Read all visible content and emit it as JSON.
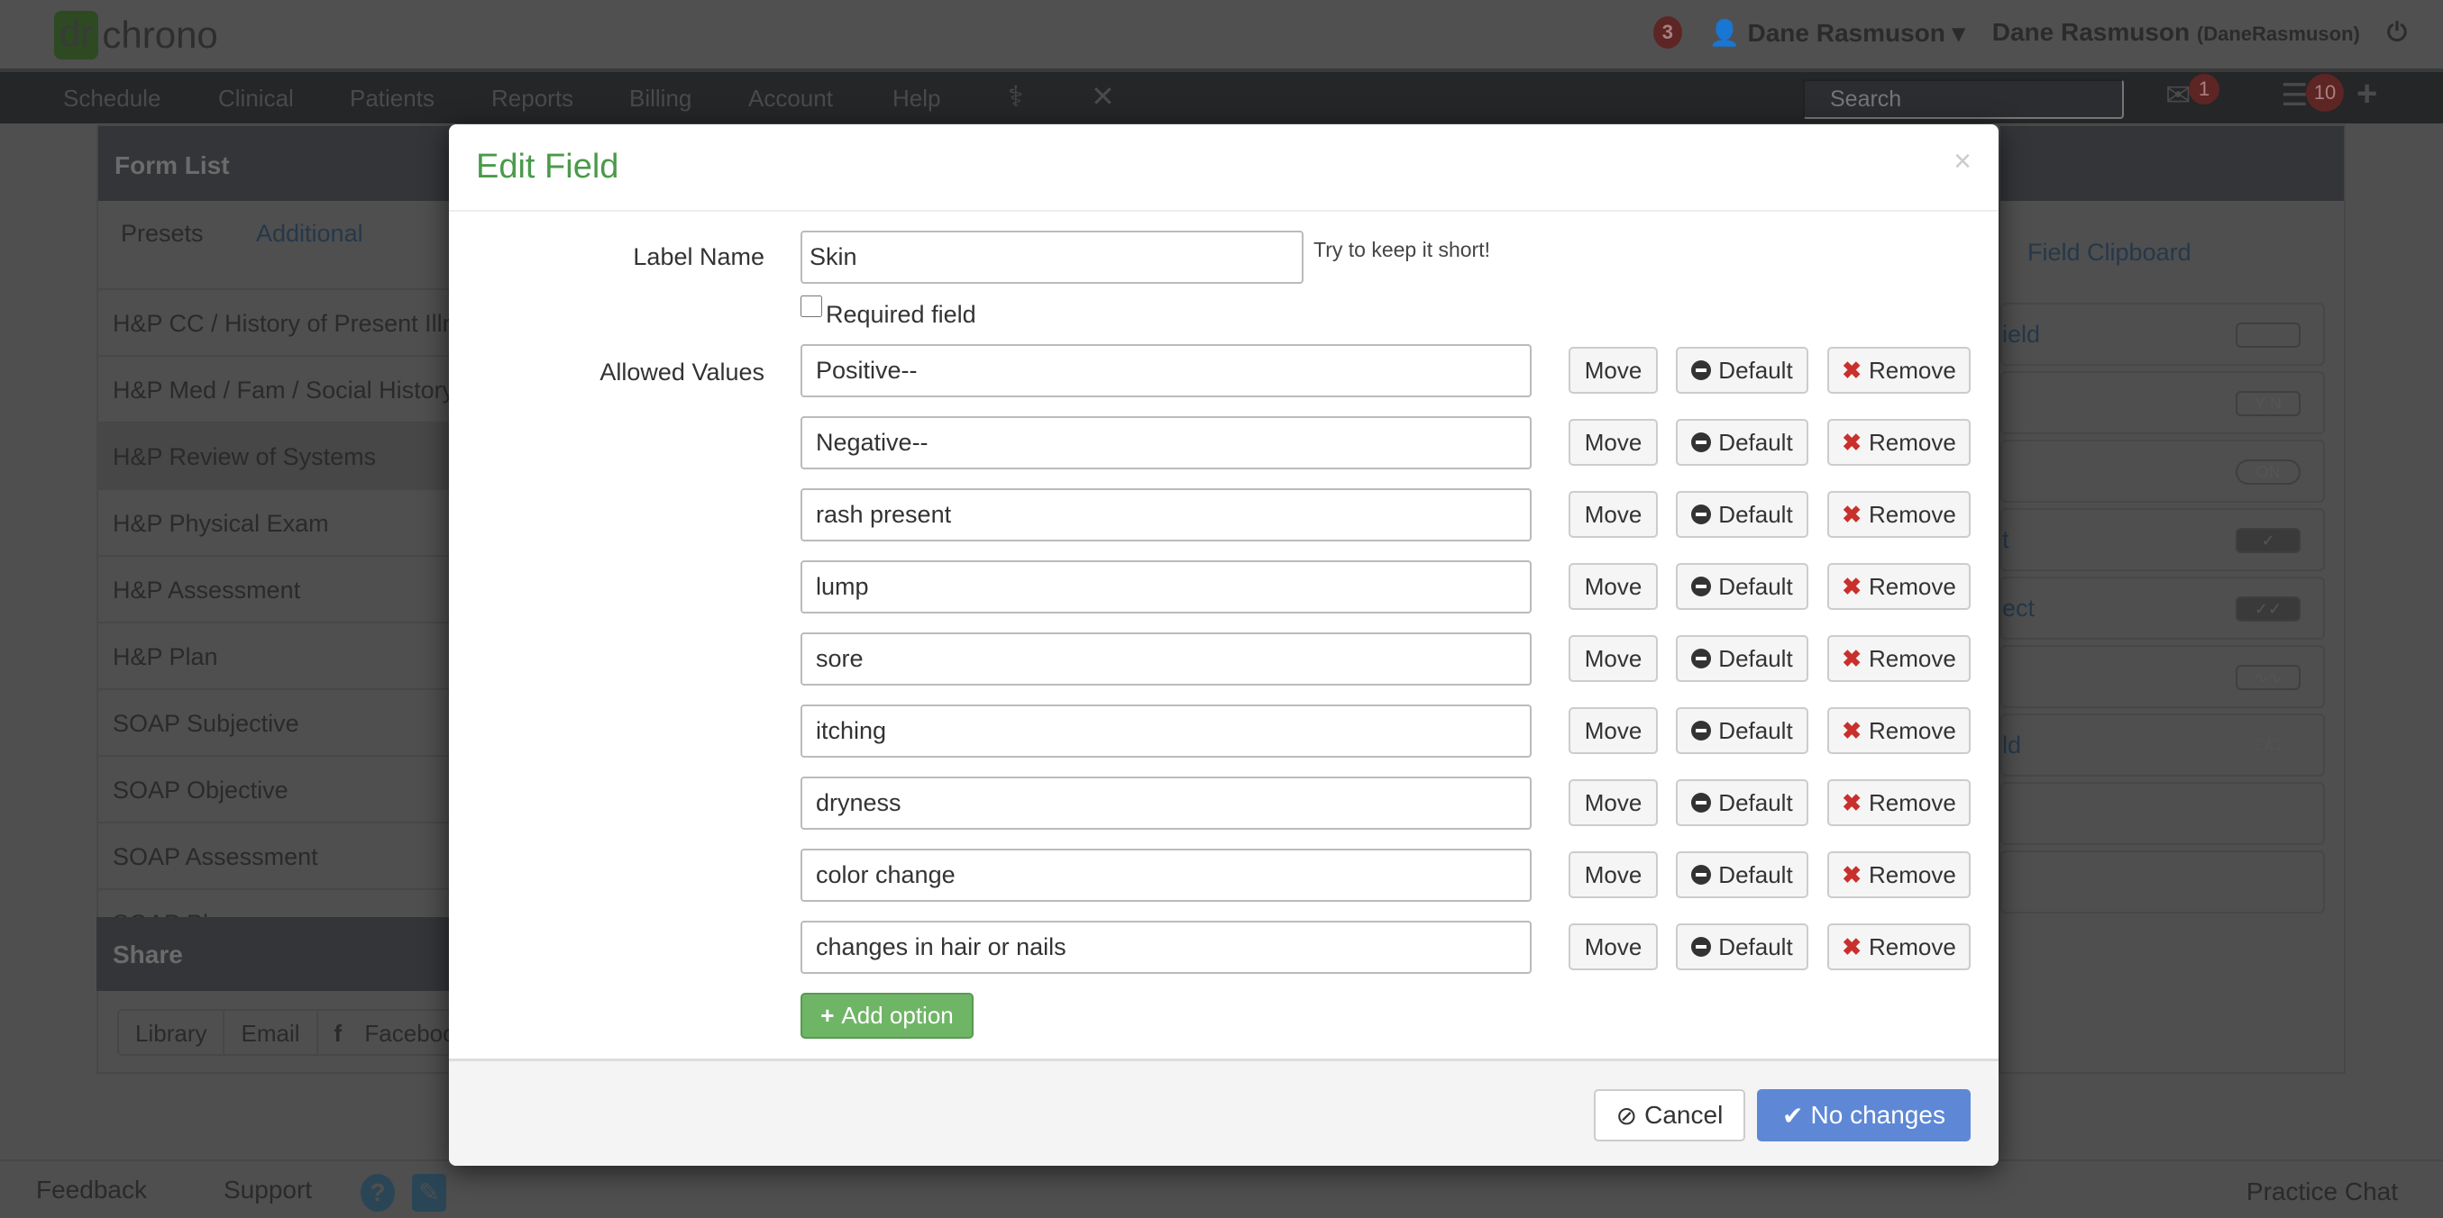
{
  "app": {
    "logo_dr": "dr",
    "logo_chrono": "chrono",
    "notifications": "3",
    "user_menu": "Dane Rasmuson",
    "user_full": "Dane Rasmuson",
    "username": "(DaneRasmuson)"
  },
  "nav": {
    "items": [
      "Schedule",
      "Clinical",
      "Patients",
      "Reports",
      "Billing",
      "Account",
      "Help"
    ],
    "search_placeholder": "Search",
    "mail_badge": "1",
    "tasks_badge": "10"
  },
  "left_panel": {
    "title": "Form List",
    "tabs": [
      "Presets",
      "Additional"
    ],
    "items": [
      "H&P CC / History of Present Illness",
      "H&P Med / Fam / Social History",
      "H&P Review of Systems",
      "H&P Physical Exam",
      "H&P Assessment",
      "H&P Plan",
      "SOAP Subjective",
      "SOAP Objective",
      "SOAP Assessment",
      "SOAP Plan"
    ],
    "share_title": "Share",
    "share_buttons": [
      "Library",
      "Email",
      "Facebook"
    ]
  },
  "right_panel": {
    "tab": "Field Clipboard",
    "items": [
      "ield",
      "",
      "",
      "t",
      "ect",
      "",
      "ld",
      "",
      ""
    ],
    "icons": [
      "",
      "Y N",
      "ON",
      "✓",
      "✓✓",
      "∿∿",
      "□/□",
      "",
      ""
    ]
  },
  "footer": {
    "feedback": "Feedback",
    "support": "Support",
    "practice_chat": "Practice Chat"
  },
  "modal": {
    "title": "Edit Field",
    "close": "×",
    "label_name_label": "Label Name",
    "label_name_value": "Skin",
    "hint": "Try to keep it short!",
    "required_label": "Required field",
    "required_checked": false,
    "allowed_values_label": "Allowed Values",
    "values": [
      "Positive--",
      "Negative--",
      "rash present",
      "lump",
      "sore",
      "itching",
      "dryness",
      "color change",
      "changes in hair or nails"
    ],
    "move_label": "Move",
    "default_label": "Default",
    "remove_label": "Remove",
    "add_option": "Add option",
    "cancel": "Cancel",
    "save": "No changes"
  },
  "colors": {
    "title_green": "#4a9a4a",
    "add_green": "#6fb566",
    "save_blue": "#5e88d6",
    "remove_red": "#c9302c"
  }
}
